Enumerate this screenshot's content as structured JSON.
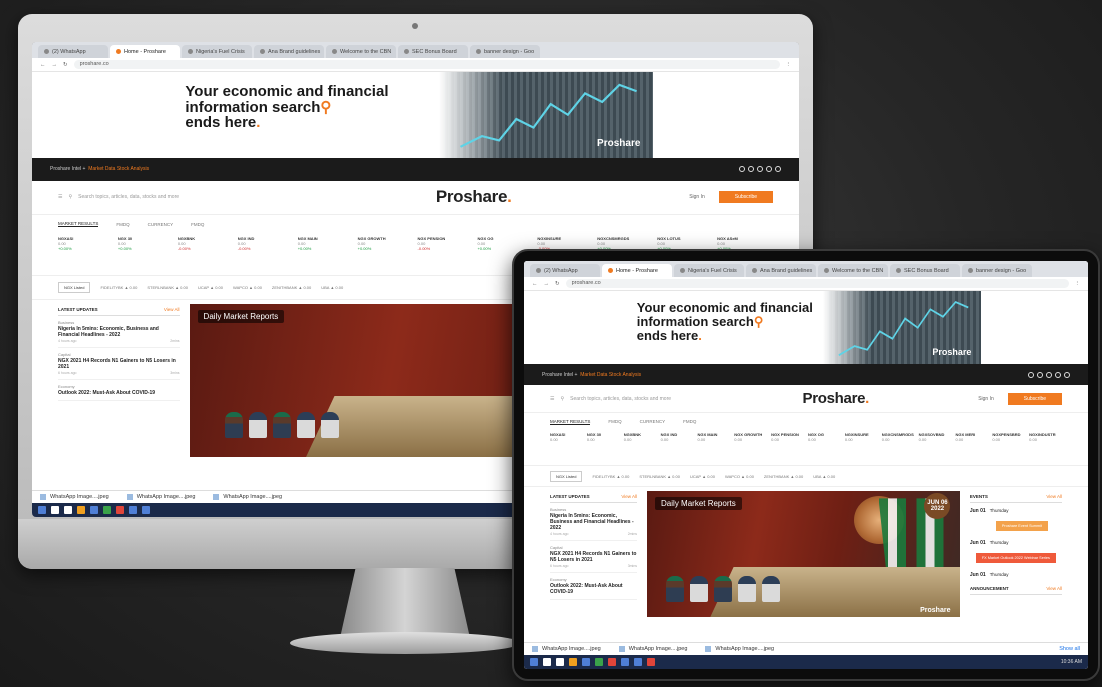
{
  "browser": {
    "tabs": [
      {
        "label": "(2) WhatsApp",
        "active": false
      },
      {
        "label": "Home - Proshare",
        "active": true
      },
      {
        "label": "Nigeria's Fuel Crisis",
        "active": false
      },
      {
        "label": "Ana Brand guidelines",
        "active": false
      },
      {
        "label": "Welcome to the CBN",
        "active": false
      },
      {
        "label": "SEC Bonus Board",
        "active": false
      },
      {
        "label": "banner design - Goo",
        "active": false
      }
    ],
    "url": "proshare.co"
  },
  "banner": {
    "line1": "Your economic and financial",
    "line2": "information search",
    "line3": "ends here",
    "brand": "Proshare"
  },
  "topbar": {
    "left": "Proshare Intel +",
    "orange": "Market Data  Stock Analysis"
  },
  "header": {
    "search_placeholder": "Search topics, articles, data, stocks and more",
    "logo": "Proshare",
    "signin": "Sign In",
    "subscribe": "Subscribe"
  },
  "market_tabs": [
    "MARKET RESULTS",
    "FMDQ",
    "CURRENCY",
    "FMDQ"
  ],
  "ticker": [
    {
      "name": "NGXASI",
      "value": "0.00",
      "change": "+0.00%",
      "dir": "u"
    },
    {
      "name": "NGX 30",
      "value": "0.00",
      "change": "+0.00%",
      "dir": "u"
    },
    {
      "name": "NGXBNK",
      "value": "0.00",
      "change": "-0.00%",
      "dir": "d"
    },
    {
      "name": "NGX IND",
      "value": "0.00",
      "change": "-0.00%",
      "dir": "d"
    },
    {
      "name": "NGX MAIN",
      "value": "0.00",
      "change": "+0.00%",
      "dir": "u"
    },
    {
      "name": "NGX GROWTH",
      "value": "0.00",
      "change": "+0.00%",
      "dir": "u"
    },
    {
      "name": "NGX PENSION",
      "value": "0.00",
      "change": "-0.00%",
      "dir": "d"
    },
    {
      "name": "NGX OG",
      "value": "0.00",
      "change": "+0.00%",
      "dir": "u"
    },
    {
      "name": "NGXINSURE",
      "value": "0.00",
      "change": "-0.00%",
      "dir": "d"
    },
    {
      "name": "NGXCNSMRGDS",
      "value": "0.00",
      "change": "+0.00%",
      "dir": "u"
    },
    {
      "name": "NGX LOTUS",
      "value": "0.00",
      "change": "+0.00%",
      "dir": "u"
    },
    {
      "name": "NGX ASeM",
      "value": "0.00",
      "change": "+0.00%",
      "dir": "u"
    },
    {
      "name": "NGXSOVBND",
      "value": "0.00",
      "change": "+0.00%",
      "dir": "u"
    },
    {
      "name": "NGX MERI",
      "value": "0.00",
      "change": "+0.00%",
      "dir": "u"
    },
    {
      "name": "NGXPENSBRD",
      "value": "0.00",
      "change": "+0.00%",
      "dir": "u"
    },
    {
      "name": "NGXINDUSTR",
      "value": "0.00",
      "change": "+0.00%",
      "dir": "u"
    }
  ],
  "strip": {
    "select": "NGX Listed",
    "items": [
      "FIDELITYBK ▲ 0.00",
      "STERLNBANK ▲ 0.00",
      "UCAP ▲ 0.00",
      "WAPCO ▲ 0.00",
      "ZENITHBANK ▲ 0.00",
      "UBA ▲ 0.00"
    ]
  },
  "sidebar": {
    "heading": "LATEST UPDATES",
    "more": "View All",
    "items": [
      {
        "cat": "Business",
        "title": "Nigeria In 5mins: Economic, Business and Financial Headlines - 2022",
        "time": "4 hours ago",
        "len": "2mins"
      },
      {
        "cat": "Capital",
        "title": "NGX 2021 H4 Records N1 Gainers to N5 Losers in 2021",
        "time": "6 hours ago",
        "len": "3mins"
      },
      {
        "cat": "Economy",
        "title": "Outlook 2022: Must-Ask About COVID-19",
        "time": "8 hours ago",
        "len": "4mins"
      }
    ]
  },
  "feature": {
    "label": "Daily Market Reports",
    "date": "JUN 06 2022",
    "watermark": "Proshare"
  },
  "rightcol": {
    "heading": "EVENTS",
    "more": "View All",
    "events": [
      {
        "date": "Jun 01",
        "day": "Thursday",
        "pill": "Proshare Event Summit",
        "color": "orange"
      },
      {
        "date": "Jun 01",
        "day": "Thursday",
        "pill": "FX Market Outlook 2022 Webinar Series",
        "color": "red"
      },
      {
        "date": "Jun 01",
        "day": "Thursday",
        "pill": "",
        "color": ""
      }
    ],
    "section2": "ANNOUNCEMENT",
    "more2": "View All"
  },
  "downloads": {
    "files": [
      "WhatsApp Image....jpeg",
      "WhatsApp Image....jpeg",
      "WhatsApp Image....jpeg"
    ],
    "show_all": "Show all"
  },
  "taskbar": {
    "clock": "10:36 AM"
  }
}
